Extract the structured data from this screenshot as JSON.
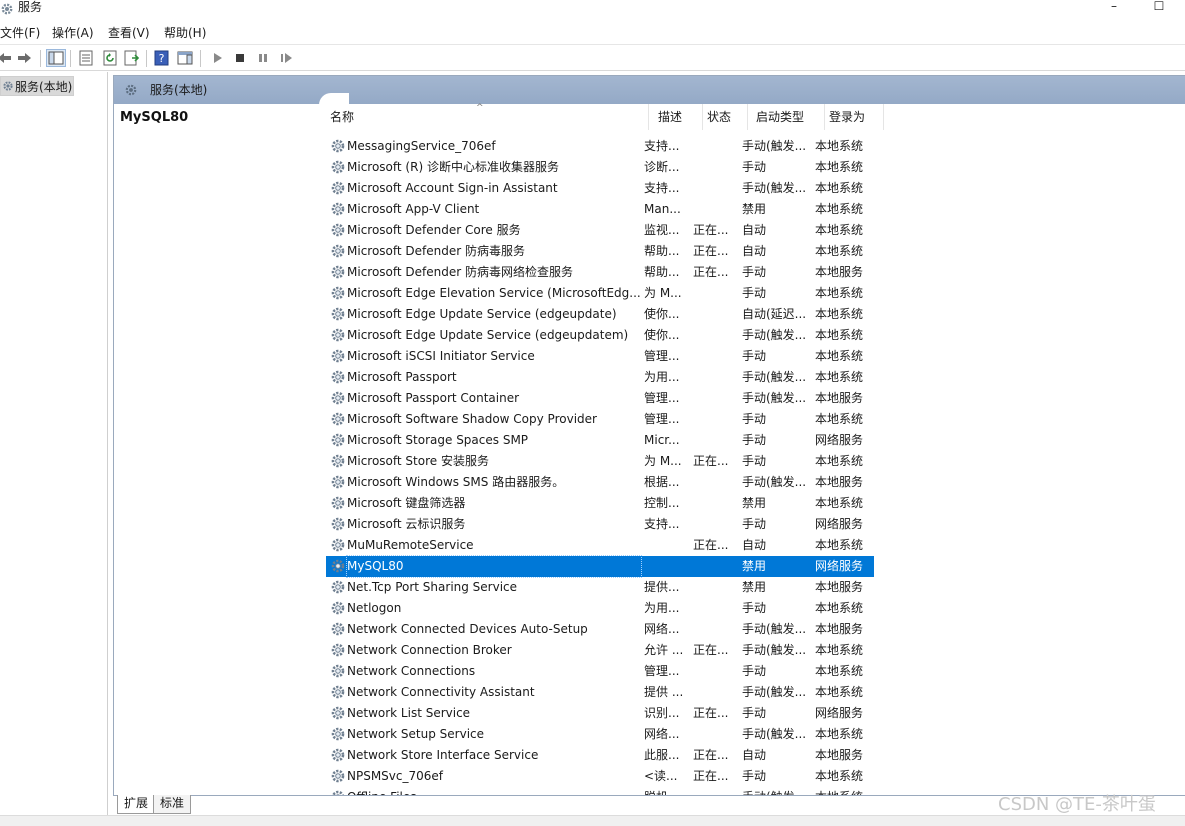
{
  "window": {
    "title": "服务",
    "minimize_glyph": "–",
    "maximize_glyph": "☐"
  },
  "menu": [
    "文件(F)",
    "操作(A)",
    "查看(V)",
    "帮助(H)"
  ],
  "tree": {
    "root_label": "服务(本地)"
  },
  "pane": {
    "header_label": "服务(本地)",
    "selected_service_title": "MySQL80"
  },
  "columns": {
    "name": "名称",
    "desc": "描述",
    "status": "状态",
    "startup": "启动类型",
    "logon": "登录为",
    "sort_glyph": "^"
  },
  "services": [
    {
      "name": "MessagingService_706ef",
      "desc": "支持...",
      "status": "",
      "startup": "手动(触发...",
      "logon": "本地系统"
    },
    {
      "name": "Microsoft (R) 诊断中心标准收集器服务",
      "desc": "诊断...",
      "status": "",
      "startup": "手动",
      "logon": "本地系统"
    },
    {
      "name": "Microsoft Account Sign-in Assistant",
      "desc": "支持...",
      "status": "",
      "startup": "手动(触发...",
      "logon": "本地系统"
    },
    {
      "name": "Microsoft App-V Client",
      "desc": "Man...",
      "status": "",
      "startup": "禁用",
      "logon": "本地系统"
    },
    {
      "name": "Microsoft Defender Core 服务",
      "desc": "监视...",
      "status": "正在...",
      "startup": "自动",
      "logon": "本地系统"
    },
    {
      "name": "Microsoft Defender 防病毒服务",
      "desc": "帮助...",
      "status": "正在...",
      "startup": "自动",
      "logon": "本地系统"
    },
    {
      "name": "Microsoft Defender 防病毒网络检查服务",
      "desc": "帮助...",
      "status": "正在...",
      "startup": "手动",
      "logon": "本地服务"
    },
    {
      "name": "Microsoft Edge Elevation Service (MicrosoftEdg...",
      "desc": "为 M...",
      "status": "",
      "startup": "手动",
      "logon": "本地系统"
    },
    {
      "name": "Microsoft Edge Update Service (edgeupdate)",
      "desc": "使你...",
      "status": "",
      "startup": "自动(延迟...",
      "logon": "本地系统"
    },
    {
      "name": "Microsoft Edge Update Service (edgeupdatem)",
      "desc": "使你...",
      "status": "",
      "startup": "手动(触发...",
      "logon": "本地系统"
    },
    {
      "name": "Microsoft iSCSI Initiator Service",
      "desc": "管理...",
      "status": "",
      "startup": "手动",
      "logon": "本地系统"
    },
    {
      "name": "Microsoft Passport",
      "desc": "为用...",
      "status": "",
      "startup": "手动(触发...",
      "logon": "本地系统"
    },
    {
      "name": "Microsoft Passport Container",
      "desc": "管理...",
      "status": "",
      "startup": "手动(触发...",
      "logon": "本地服务"
    },
    {
      "name": "Microsoft Software Shadow Copy Provider",
      "desc": "管理...",
      "status": "",
      "startup": "手动",
      "logon": "本地系统"
    },
    {
      "name": "Microsoft Storage Spaces SMP",
      "desc": "Micr...",
      "status": "",
      "startup": "手动",
      "logon": "网络服务"
    },
    {
      "name": "Microsoft Store 安装服务",
      "desc": "为 M...",
      "status": "正在...",
      "startup": "手动",
      "logon": "本地系统"
    },
    {
      "name": "Microsoft Windows SMS 路由器服务。",
      "desc": "根据...",
      "status": "",
      "startup": "手动(触发...",
      "logon": "本地服务"
    },
    {
      "name": "Microsoft 键盘筛选器",
      "desc": "控制...",
      "status": "",
      "startup": "禁用",
      "logon": "本地系统"
    },
    {
      "name": "Microsoft 云标识服务",
      "desc": "支持...",
      "status": "",
      "startup": "手动",
      "logon": "网络服务"
    },
    {
      "name": "MuMuRemoteService",
      "desc": "",
      "status": "正在...",
      "startup": "自动",
      "logon": "本地系统"
    },
    {
      "name": "MySQL80",
      "desc": "",
      "status": "",
      "startup": "禁用",
      "logon": "网络服务",
      "selected": true
    },
    {
      "name": "Net.Tcp Port Sharing Service",
      "desc": "提供...",
      "status": "",
      "startup": "禁用",
      "logon": "本地服务"
    },
    {
      "name": "Netlogon",
      "desc": "为用...",
      "status": "",
      "startup": "手动",
      "logon": "本地系统"
    },
    {
      "name": "Network Connected Devices Auto-Setup",
      "desc": "网络...",
      "status": "",
      "startup": "手动(触发...",
      "logon": "本地服务"
    },
    {
      "name": "Network Connection Broker",
      "desc": "允许 ...",
      "status": "正在...",
      "startup": "手动(触发...",
      "logon": "本地系统"
    },
    {
      "name": "Network Connections",
      "desc": "管理...",
      "status": "",
      "startup": "手动",
      "logon": "本地系统"
    },
    {
      "name": "Network Connectivity Assistant",
      "desc": "提供 ...",
      "status": "",
      "startup": "手动(触发...",
      "logon": "本地系统"
    },
    {
      "name": "Network List Service",
      "desc": "识别...",
      "status": "正在...",
      "startup": "手动",
      "logon": "网络服务"
    },
    {
      "name": "Network Setup Service",
      "desc": "网络...",
      "status": "",
      "startup": "手动(触发...",
      "logon": "本地系统"
    },
    {
      "name": "Network Store Interface Service",
      "desc": "此服...",
      "status": "正在...",
      "startup": "自动",
      "logon": "本地服务"
    },
    {
      "name": "NPSMSvc_706ef",
      "desc": "<读...",
      "status": "正在...",
      "startup": "手动",
      "logon": "本地系统"
    },
    {
      "name": "Offline Files",
      "desc": "脱机...",
      "status": "",
      "startup": "手动(触发...",
      "logon": "本地系统"
    }
  ],
  "tabs": {
    "extended": "扩展",
    "standard": "标准"
  },
  "watermark": "CSDN @TE-茶叶蛋",
  "colors": {
    "selection": "#0078d7",
    "header": "#a3b6d0"
  }
}
